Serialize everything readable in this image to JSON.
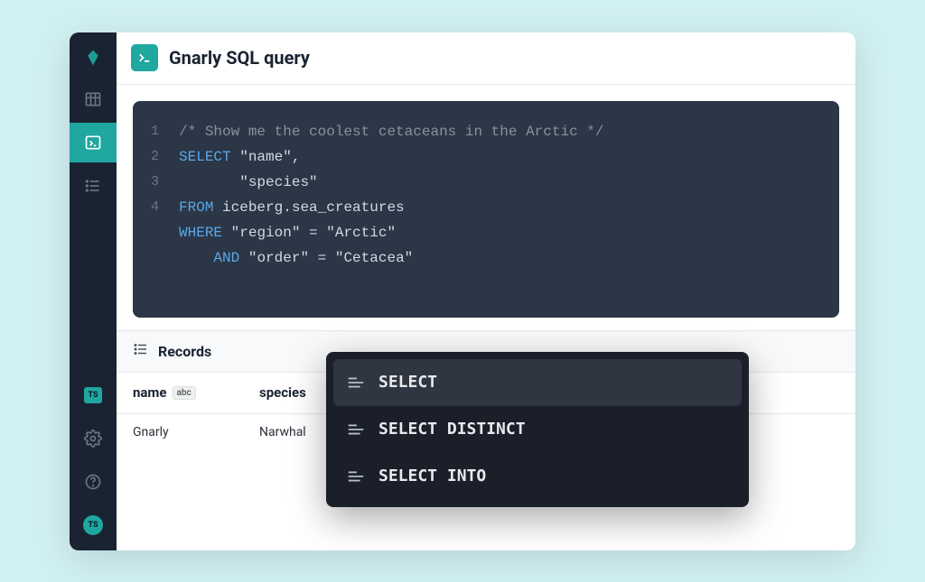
{
  "header": {
    "title": "Gnarly SQL query"
  },
  "sidebar": {
    "ts_badge": "TS"
  },
  "editor": {
    "line_numbers": [
      "1",
      "2",
      "3",
      "4"
    ],
    "lines": {
      "l1_comment": "/* Show me the coolest cetaceans in the Arctic */",
      "l2_kw": "SELECT",
      "l2_rest": " \"name\",",
      "l3": "       \"species\"",
      "l4_kw": "FROM",
      "l4_rest": " iceberg.sea_creatures",
      "l5_kw": "WHERE",
      "l5_rest": " \"region\" = \"Arctic\"",
      "l6_pad": "    ",
      "l6_kw": "AND",
      "l6_rest": " \"order\" = \"Cetacea\""
    }
  },
  "results": {
    "title": "Records",
    "columns": {
      "name": {
        "label": "name",
        "type": "abc"
      },
      "species": {
        "label": "species"
      }
    },
    "rows": [
      {
        "name": "Gnarly",
        "species": "Narwhal"
      }
    ]
  },
  "autocomplete": {
    "items": [
      {
        "label": "SELECT",
        "selected": true
      },
      {
        "label": "SELECT DISTINCT",
        "selected": false
      },
      {
        "label": "SELECT INTO",
        "selected": false
      }
    ]
  }
}
